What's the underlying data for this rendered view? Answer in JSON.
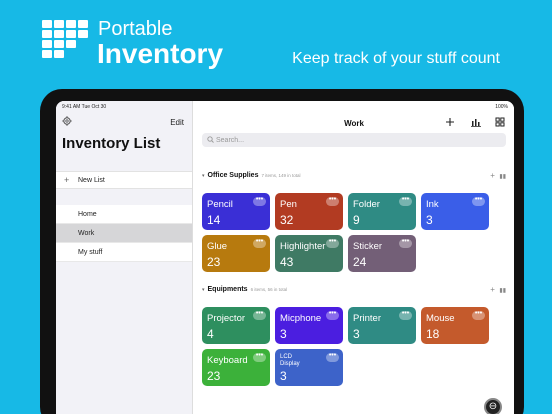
{
  "promo": {
    "app_name_line1": "Portable",
    "app_name_line2": "Inventory",
    "tagline": "Keep track of your stuff count"
  },
  "statusbar": {
    "time": "9:41 AM  Tue Oct 30",
    "battery": "100%"
  },
  "sidebar": {
    "edit_label": "Edit",
    "title": "Inventory List",
    "new_list_label": "New List",
    "items": [
      {
        "label": "Home",
        "active": false
      },
      {
        "label": "Work",
        "active": true
      },
      {
        "label": "My stuff",
        "active": false
      }
    ]
  },
  "main": {
    "title": "Work",
    "search_placeholder": "Search...",
    "sections": [
      {
        "name": "Office Supplies",
        "count_text": "7 items, 149 in total",
        "items": [
          {
            "name": "Pencil",
            "count": "14",
            "color": "#3a2fd6"
          },
          {
            "name": "Pen",
            "count": "32",
            "color": "#b23b22"
          },
          {
            "name": "Folder",
            "count": "9",
            "color": "#2f8b84"
          },
          {
            "name": "Ink",
            "count": "3",
            "color": "#3a5ee8"
          },
          {
            "name": "Glue",
            "count": "23",
            "color": "#b77a0e"
          },
          {
            "name": "Highlighter",
            "count": "43",
            "color": "#3f7a64"
          },
          {
            "name": "Sticker",
            "count": "24",
            "color": "#735f77"
          }
        ]
      },
      {
        "name": "Equipments",
        "count_text": "6 items, 56 in total",
        "items": [
          {
            "name": "Projector",
            "count": "4",
            "color": "#2e8f5f"
          },
          {
            "name": "Micphone",
            "count": "3",
            "color": "#4b1ee0"
          },
          {
            "name": "Printer",
            "count": "3",
            "color": "#2f8b84"
          },
          {
            "name": "Mouse",
            "count": "18",
            "color": "#c45a2c"
          },
          {
            "name": "Keyboard",
            "count": "23",
            "color": "#3cb13a"
          },
          {
            "name": "LCD Display",
            "count": "3",
            "color": "#3d63c9"
          }
        ]
      }
    ]
  },
  "colors": {
    "background": "#17b9e6",
    "device": "#111111"
  }
}
